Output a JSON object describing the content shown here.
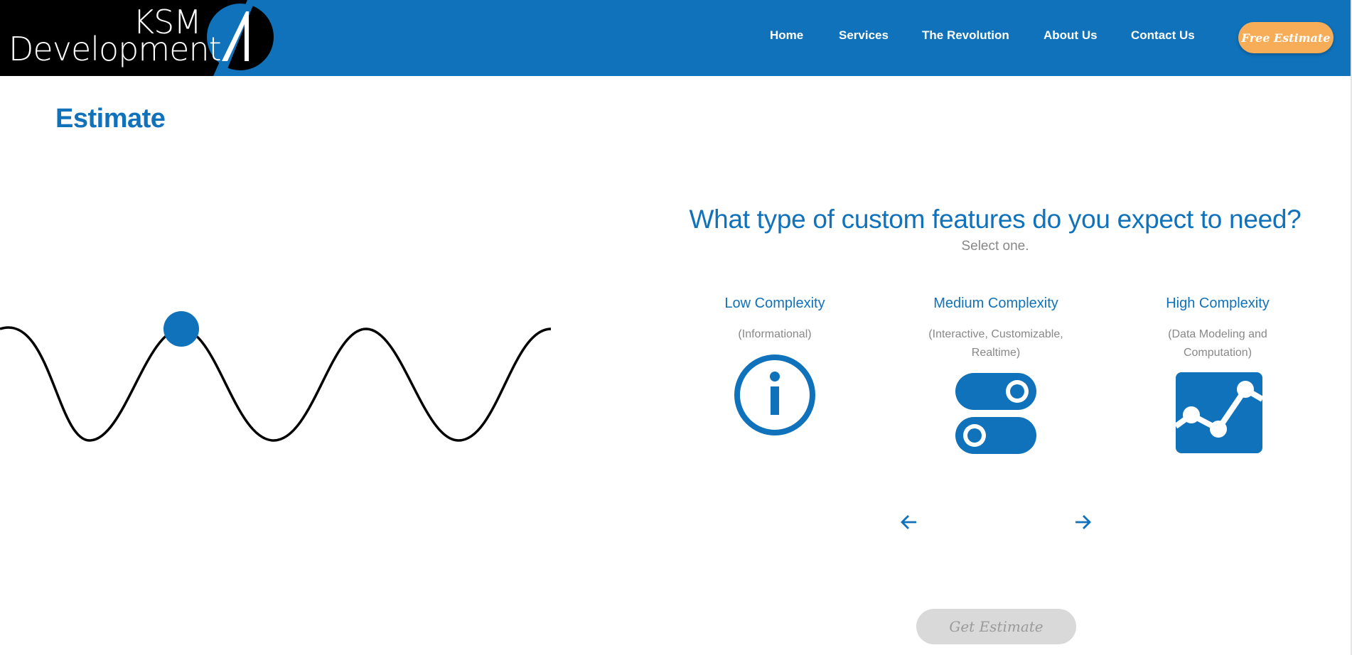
{
  "brand": {
    "line1": "KSM",
    "line2": "Development",
    "primary_color": "#0f72ba",
    "accent_color": "#f7ad57"
  },
  "nav": {
    "items": [
      "Home",
      "Services",
      "The Revolution",
      "About Us",
      "Contact Us"
    ],
    "cta": "Free Estimate"
  },
  "page": {
    "title": "Estimate",
    "progress_icon": "wave-progress-indicator"
  },
  "step": {
    "question": "What type of custom features do you expect to need?",
    "hint": "Select one.",
    "options": [
      {
        "title": "Low Complexity",
        "desc": "(Informational)",
        "icon": "info-icon"
      },
      {
        "title": "Medium Complexity",
        "desc": "(Interactive, Customizable, Realtime)",
        "icon": "toggle-switches-icon"
      },
      {
        "title": "High Complexity",
        "desc": "(Data Modeling and Computation)",
        "icon": "line-chart-icon"
      }
    ],
    "prev_icon": "arrow-left-icon",
    "next_icon": "arrow-right-icon",
    "submit": "Get Estimate"
  }
}
